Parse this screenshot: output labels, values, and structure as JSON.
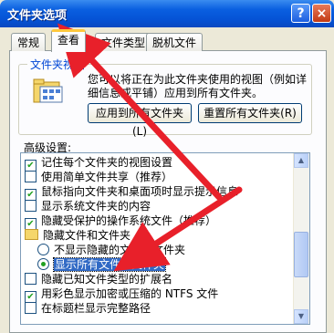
{
  "window": {
    "title": "文件夹选项",
    "help_glyph": "?",
    "close_glyph": "×"
  },
  "tabs": [
    {
      "label": "常规",
      "active": false
    },
    {
      "label": "查看",
      "active": true
    },
    {
      "label": "文件类型",
      "active": false
    },
    {
      "label": "脱机文件",
      "active": false
    }
  ],
  "folder_views": {
    "group_title": "文件夹视图",
    "description": "您可以将正在为此文件夹使用的视图（例如详细信息或平铺）应用到所有文件夹。",
    "apply_all_button": "应用到所有文件夹(L)",
    "reset_all_button": "重置所有文件夹(R)"
  },
  "advanced": {
    "label": "高级设置:",
    "items": [
      {
        "type": "checkbox",
        "checked": true,
        "label": "记住每个文件夹的视图设置"
      },
      {
        "type": "checkbox",
        "checked": false,
        "label": "使用简单文件共享（推荐）"
      },
      {
        "type": "checkbox",
        "checked": true,
        "label": "鼠标指向文件夹和桌面项时显示提示信息"
      },
      {
        "type": "checkbox",
        "checked": false,
        "label": "显示系统文件夹的内容"
      },
      {
        "type": "checkbox",
        "checked": true,
        "label": "隐藏受保护的操作系统文件（推荐）"
      },
      {
        "type": "folder",
        "label": "隐藏文件和文件夹"
      },
      {
        "type": "radio",
        "checked": false,
        "label": "不显示隐藏的文件和文件夹"
      },
      {
        "type": "radio",
        "checked": true,
        "label": "显示所有文件和文件夹",
        "selected": true
      },
      {
        "type": "checkbox",
        "checked": false,
        "label": "隐藏已知文件类型的扩展名"
      },
      {
        "type": "checkbox",
        "checked": true,
        "label": "用彩色显示加密或压缩的 NTFS 文件"
      },
      {
        "type": "checkbox",
        "checked": false,
        "label": "在标题栏显示完整路径"
      }
    ]
  },
  "colors": {
    "annotation_arrow": "#e8202a",
    "title_bar": "#0553d6",
    "selection": "#316ac5"
  }
}
